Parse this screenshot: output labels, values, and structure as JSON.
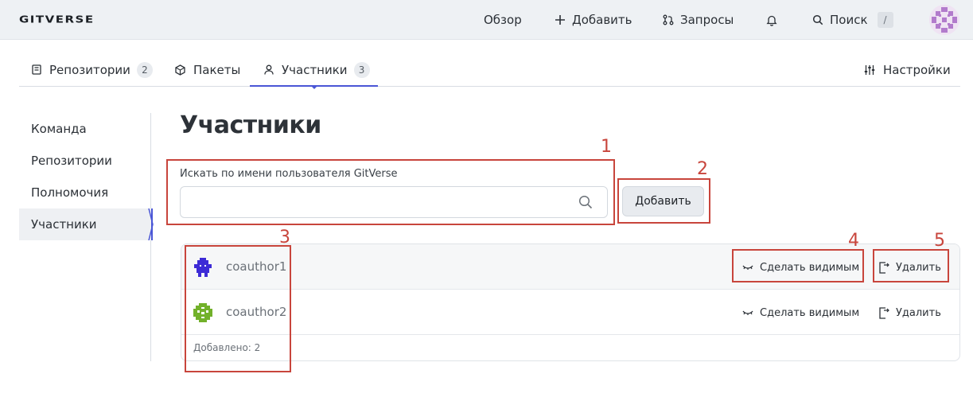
{
  "header": {
    "logo": "GITVERSE",
    "nav": {
      "overview": "Обзор",
      "add": "Добавить",
      "requests": "Запросы",
      "search": "Поиск",
      "search_shortcut": "/"
    }
  },
  "tabs": {
    "repositories": {
      "label": "Репозитории",
      "count": "2"
    },
    "packages": {
      "label": "Пакеты"
    },
    "members": {
      "label": "Участники",
      "count": "3"
    },
    "settings": {
      "label": "Настройки"
    }
  },
  "sidebar": {
    "items": [
      {
        "label": "Команда"
      },
      {
        "label": "Репозитории"
      },
      {
        "label": "Полномочия"
      },
      {
        "label": "Участники"
      }
    ]
  },
  "main": {
    "title": "Участники",
    "search": {
      "label": "Искать по имени пользователя GitVerse",
      "value": "",
      "placeholder": ""
    },
    "add_button": "Добавить",
    "members": [
      {
        "name": "coauthor1",
        "make_visible": "Сделать видимым",
        "remove": "Удалить"
      },
      {
        "name": "coauthor2",
        "make_visible": "Сделать видимым",
        "remove": "Удалить"
      }
    ],
    "footer": "Добавлено: 2"
  },
  "annotations": [
    "1",
    "2",
    "3",
    "4",
    "5"
  ],
  "colors": {
    "accent": "#4a56d6",
    "annotation": "#c8453c",
    "topbar_bg": "#eef1f4"
  },
  "icons": {
    "add": "plus-icon",
    "requests": "pull-request-icon",
    "notifications": "bell-icon",
    "search": "search-icon",
    "repositories": "book-icon",
    "packages": "package-icon",
    "members": "person-icon",
    "settings": "sliders-icon",
    "make_visible": "eye-closed-icon",
    "remove": "leave-icon"
  }
}
